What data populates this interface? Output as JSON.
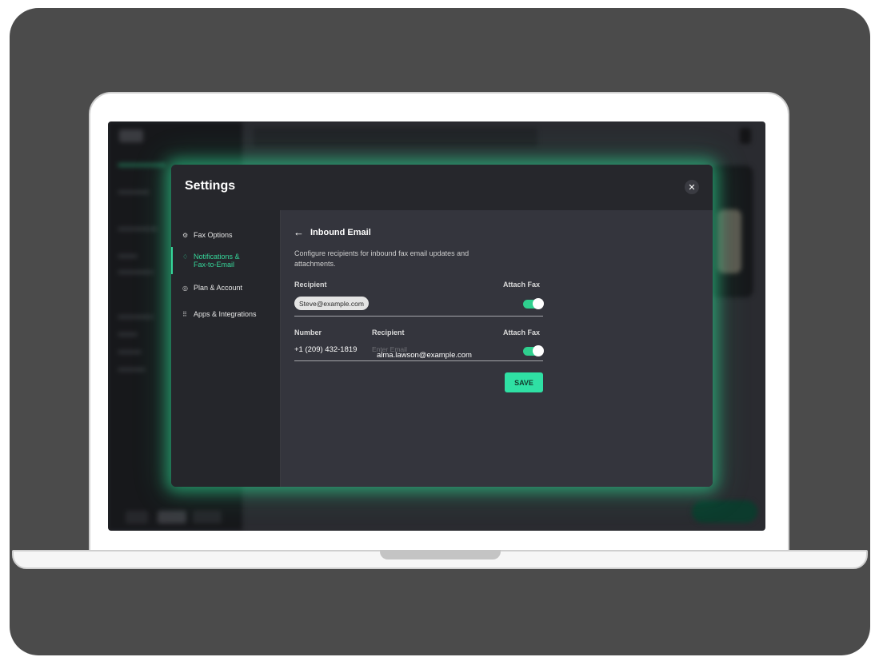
{
  "modal": {
    "title": "Settings",
    "close_glyph": "✕"
  },
  "sidebar": {
    "items": [
      {
        "label": "Fax Options",
        "icon": "gear-icon",
        "glyph": "⚙"
      },
      {
        "label": "Notifications & Fax-to-Email",
        "icon": "bell-icon",
        "glyph": "♢"
      },
      {
        "label": "Plan & Account",
        "icon": "user-circle-icon",
        "glyph": "◎"
      },
      {
        "label": "Apps & Integrations",
        "icon": "grid-icon",
        "glyph": "⠿"
      }
    ],
    "active_index": 1
  },
  "content": {
    "back_glyph": "←",
    "title": "Inbound Email",
    "description": "Configure recipients for inbound fax email updates and attachments.",
    "group1": {
      "recipient_header": "Recipient",
      "attach_header": "Attach Fax",
      "chip": "Steve@example.com",
      "attach_on": true
    },
    "group2": {
      "number_header": "Number",
      "recipient_header": "Recipient",
      "attach_header": "Attach Fax",
      "number": "+1 (209) 432-1819",
      "email_placeholder": "Enter Email",
      "email_value": "alma.lawson@example.com",
      "attach_on": true
    },
    "save_label": "SAVE"
  },
  "colors": {
    "accent": "#2fe0a4",
    "glow": "#2edc96",
    "active_text": "#36d69a"
  }
}
